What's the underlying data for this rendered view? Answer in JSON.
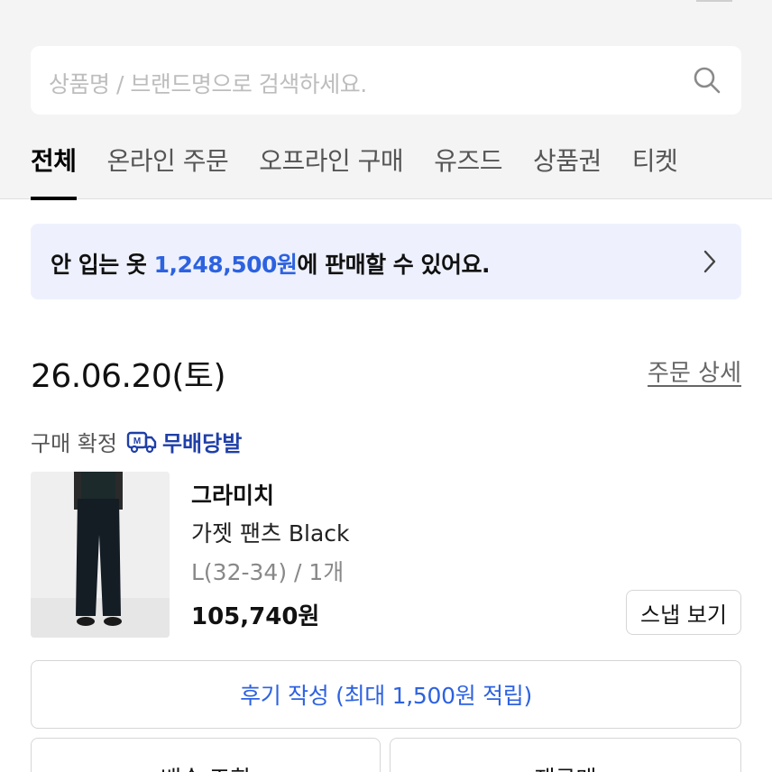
{
  "search": {
    "placeholder": "상품명 / 브랜드명으로 검색하세요."
  },
  "tabs": [
    {
      "label": "전체",
      "active": true
    },
    {
      "label": "온라인 주문",
      "active": false
    },
    {
      "label": "오프라인 구매",
      "active": false
    },
    {
      "label": "유즈드",
      "active": false
    },
    {
      "label": "상품권",
      "active": false
    },
    {
      "label": "티켓",
      "active": false
    }
  ],
  "sell_banner": {
    "prefix": "안 입는 옷 ",
    "amount": "1,248,500원",
    "suffix": "에 판매할 수 있어요.",
    "icon": "chevron-right-icon"
  },
  "order": {
    "date": "26.06.20(토)",
    "detail_link": "주문 상세",
    "status": "구매 확정",
    "delivery_badge": "무배당발",
    "delivery_icon": "delivery-truck-icon"
  },
  "product": {
    "brand": "그라미치",
    "name": "가젯 팬츠 Black",
    "option": "L(32-34) / 1개",
    "price": "105,740원",
    "snap_button": "스냅 보기"
  },
  "actions": {
    "review": "후기 작성 (최대 1,500원 적립)",
    "track": "배송 조회",
    "resell": "재구매"
  },
  "colors": {
    "accent_blue": "#2d62e0",
    "badge_navy": "#1f3fa8",
    "banner_bg": "#eef1fd",
    "top_bg": "#f4f4f4"
  }
}
